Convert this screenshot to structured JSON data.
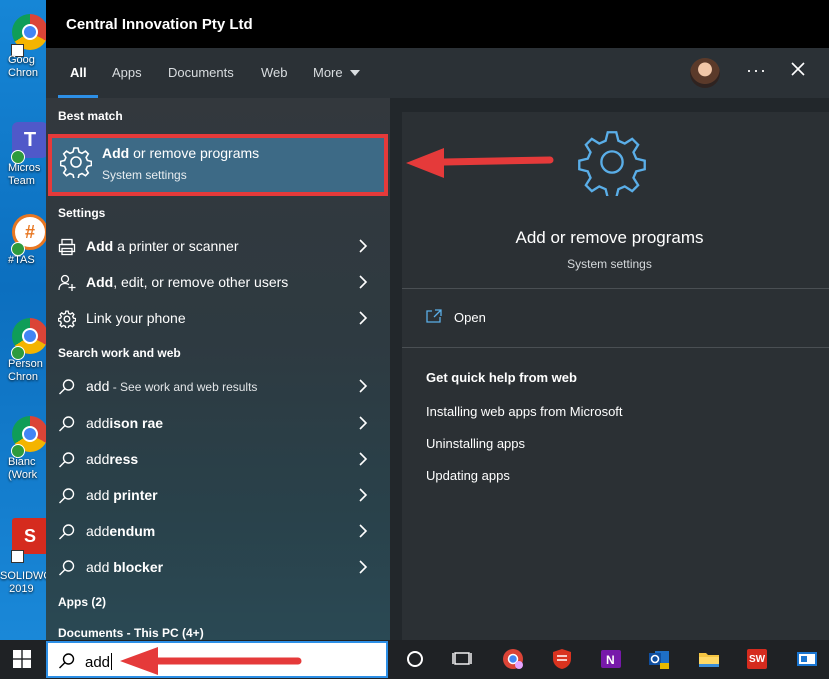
{
  "header": {
    "org_name": "Central Innovation Pty Ltd"
  },
  "tabs": [
    {
      "label": "All",
      "active": true
    },
    {
      "label": "Apps"
    },
    {
      "label": "Documents"
    },
    {
      "label": "Web"
    },
    {
      "label": "More"
    }
  ],
  "header_actions": {
    "more_dots": "···",
    "close": "✕"
  },
  "results": {
    "best_match_heading": "Best match",
    "best_match": {
      "title_bold": "Add",
      "title_rest": " or remove programs",
      "subtitle": "System settings",
      "icon": "gear-icon"
    },
    "settings_heading": "Settings",
    "settings_items": [
      {
        "bold": "Add",
        "rest": " a printer or scanner",
        "icon": "printer-icon"
      },
      {
        "bold": "Add",
        "rest": ", edit, or remove other users",
        "icon": "user-add-icon"
      },
      {
        "bold": "",
        "rest": "Link your phone",
        "icon": "gear-icon"
      }
    ],
    "web_heading": "Search work and web",
    "web_items": [
      {
        "normal": "add",
        "bold": "",
        "sub": " - See work and web results"
      },
      {
        "normal": "add",
        "bold": "ison rae",
        "sub": ""
      },
      {
        "normal": "add",
        "bold": "ress",
        "sub": ""
      },
      {
        "normal": "add ",
        "bold": "printer",
        "sub": ""
      },
      {
        "normal": "add",
        "bold": "endum",
        "sub": ""
      },
      {
        "normal": "add ",
        "bold": "blocker",
        "sub": ""
      }
    ],
    "apps_heading": "Apps (2)",
    "documents_heading": "Documents - This PC (4+)"
  },
  "detail": {
    "title": "Add or remove programs",
    "subtitle": "System settings",
    "open_label": "Open",
    "help_heading": "Get quick help from web",
    "help_links": [
      "Installing web apps from Microsoft",
      "Uninstalling apps",
      "Updating apps"
    ]
  },
  "desktop_icons": [
    {
      "label1": "Goog",
      "label2": "Chron"
    },
    {
      "label1": "Micros",
      "label2": "Team"
    },
    {
      "label1": "#TAS",
      "label2": ""
    },
    {
      "label1": "Person",
      "label2": "Chron"
    },
    {
      "label1": "Bianc",
      "label2": "(Work"
    },
    {
      "label1": "SOLIDWO",
      "label2": "2019"
    }
  ],
  "taskbar": {
    "search_value": "add"
  },
  "colors": {
    "accent": "#2d8fe6",
    "highlight": "#e53a3a",
    "selected_row": "#3d6a86"
  }
}
